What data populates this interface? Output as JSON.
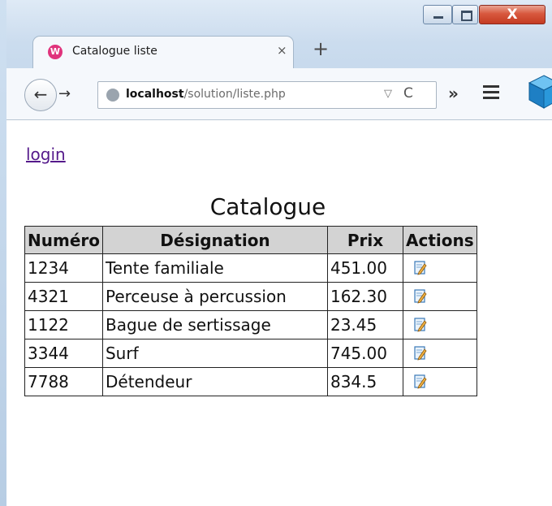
{
  "window": {
    "close_label": "X"
  },
  "tab": {
    "title": "Catalogue liste",
    "close_label": "×",
    "favicon_letter": "W",
    "new_tab_label": "+"
  },
  "toolbar": {
    "back_label": "←",
    "forward_label": "→",
    "url_host": "localhost",
    "url_path": "/solution/liste.php",
    "dropmarker": "▽",
    "reload_label": "C",
    "overflow_label": "»"
  },
  "page": {
    "login_label": "login",
    "title": "Catalogue",
    "headers": [
      "Numéro",
      "Désignation",
      "Prix",
      "Actions"
    ],
    "rows": [
      {
        "numero": "1234",
        "designation": "Tente familiale",
        "prix": "451.00"
      },
      {
        "numero": "4321",
        "designation": "Perceuse à percussion",
        "prix": "162.30"
      },
      {
        "numero": "1122",
        "designation": "Bague de sertissage",
        "prix": "23.45"
      },
      {
        "numero": "3344",
        "designation": "Surf",
        "prix": "745.00"
      },
      {
        "numero": "7788",
        "designation": "Détendeur",
        "prix": "834.5"
      }
    ]
  },
  "icons": {
    "favicon": "wamp-icon",
    "site": "globe-icon",
    "edit": "edit-icon",
    "addon": "cube-icon"
  },
  "colors": {
    "link_visited": "#551a8b",
    "header_bg": "#d3d3d3",
    "close_btn": "#c43b22"
  }
}
